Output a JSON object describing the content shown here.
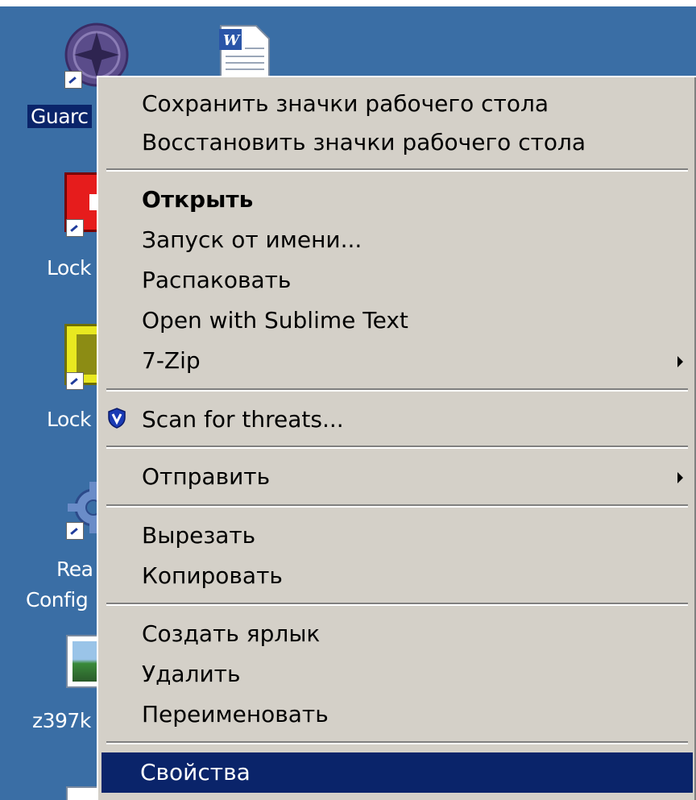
{
  "desktop": {
    "icons": [
      {
        "label": "Guarc",
        "selected": true,
        "icon": "guard-app-icon"
      },
      {
        "label": "",
        "icon": "word-document-icon"
      },
      {
        "label": "Lock",
        "icon": "lock-app-red-icon"
      },
      {
        "label": "Lock",
        "icon": "lock-app-yellow-icon"
      },
      {
        "label": "Rea",
        "label2": "Config",
        "icon": "gear-config-icon"
      },
      {
        "label": "z397k",
        "icon": "image-file-icon"
      }
    ]
  },
  "context_menu": {
    "items": [
      {
        "label": "Сохранить значки рабочего стола"
      },
      {
        "label": "Восстановить значки рабочего стола"
      },
      {
        "label": "Открыть",
        "bold": true
      },
      {
        "label": "Запуск от имени..."
      },
      {
        "label": "Распаковать"
      },
      {
        "label": "Open with Sublime Text"
      },
      {
        "label": "7-Zip",
        "submenu": true
      },
      {
        "label": "Scan for threats...",
        "icon": "shield-icon"
      },
      {
        "label": "Отправить",
        "submenu": true
      },
      {
        "label": "Вырезать"
      },
      {
        "label": "Копировать"
      },
      {
        "label": "Создать ярлык"
      },
      {
        "label": "Удалить"
      },
      {
        "label": "Переименовать"
      },
      {
        "label": "Свойства",
        "selected": true
      }
    ]
  },
  "colors": {
    "desktop": "#3a6ea5",
    "menu_bg": "#d4d0c8",
    "selection": "#0a246a"
  }
}
